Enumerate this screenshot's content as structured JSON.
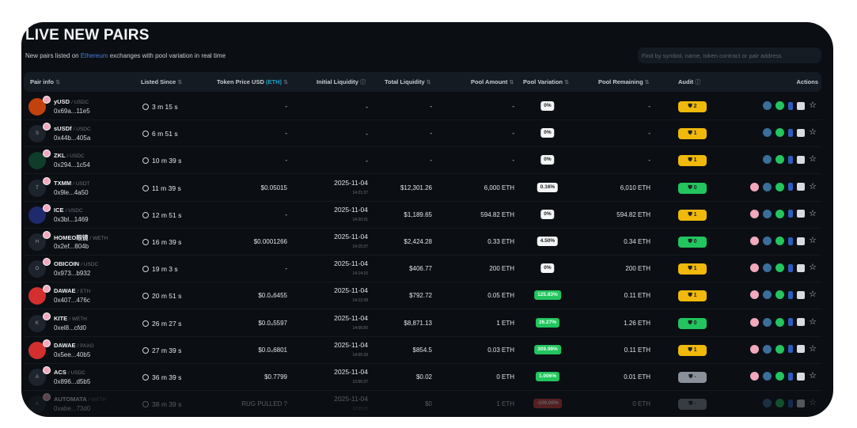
{
  "header": {
    "title": "LIVE NEW PAIRS",
    "subtitle_pre": "New pairs listed on ",
    "subtitle_link": "Ethereum",
    "subtitle_post": " exchanges with pool variation in real time",
    "search_placeholder": "Find by symbol, name, token contract or pair address"
  },
  "columns": {
    "pair_info": "Pair info",
    "listed_since": "Listed Since",
    "token_price": "Token Price USD",
    "token_price_unit": "(ETH)",
    "initial_liquidity": "Initial Liquidity",
    "total_liquidity": "Total Liquidity",
    "pool_amount": "Pool Amount",
    "pool_variation": "Pool Variation",
    "pool_remaining": "Pool Remaining",
    "audit": "Audit",
    "actions": "Actions"
  },
  "colors": {
    "audit_warn": "#f0b90b",
    "audit_ok": "#22c55e",
    "audit_none": "#8a9099",
    "variation_up": "#22c55e",
    "variation_down": "#e03e3e",
    "link": "#4b7bd8"
  },
  "rows": [
    {
      "symbol": "yUSD",
      "quote": "USDC",
      "address": "0x69a...11e5",
      "since": "3 m 15 s",
      "price": "-",
      "init_date": "-",
      "init_time": "",
      "total": "-",
      "amount": "-",
      "variation": "0%",
      "var_type": "neutral",
      "remaining": "-",
      "audit": "2",
      "audit_type": "warn",
      "avatar": "",
      "avatar_color": "#c2410c",
      "pink": false
    },
    {
      "symbol": "sUSDf",
      "quote": "USDC",
      "address": "0x44b...405a",
      "since": "6 m 51 s",
      "price": "-",
      "init_date": "-",
      "init_time": "",
      "total": "-",
      "amount": "-",
      "variation": "0%",
      "var_type": "neutral",
      "remaining": "-",
      "audit": "1",
      "audit_type": "warn",
      "avatar": "S",
      "pink": false
    },
    {
      "symbol": "ZKL",
      "quote": "USDC",
      "address": "0x294...1c54",
      "since": "10 m 39 s",
      "price": "-",
      "init_date": "-",
      "init_time": "",
      "total": "-",
      "amount": "-",
      "variation": "0%",
      "var_type": "neutral",
      "remaining": "-",
      "audit": "1",
      "audit_type": "warn",
      "avatar": "",
      "avatar_color": "#0f3d2a",
      "pink": false
    },
    {
      "symbol": "TXMM",
      "quote": "USDT",
      "address": "0x9le...4a50",
      "since": "11 m 39 s",
      "price": "$0.05015",
      "init_date": "2025-11-04",
      "init_time": "14:21:37",
      "total": "$12,301.26",
      "amount": "6,000 ETH",
      "variation": "0.16%",
      "var_type": "neutral",
      "remaining": "6,010 ETH",
      "audit": "0",
      "audit_type": "ok",
      "avatar": "T",
      "pink": true
    },
    {
      "symbol": "ICE",
      "quote": "USDC",
      "address": "0x3bl...1469",
      "since": "12 m 51 s",
      "price": "-",
      "init_date": "2025-11-04",
      "init_time": "14:20:31",
      "total": "$1,189.65",
      "amount": "594.82 ETH",
      "variation": "0%",
      "var_type": "neutral",
      "remaining": "594.82 ETH",
      "audit": "1",
      "audit_type": "warn",
      "avatar": "",
      "avatar_color": "#1e2a6b",
      "pink": true
    },
    {
      "symbol": "HOMEO眼镜",
      "quote": "WETH",
      "address": "0x2ef...804b",
      "since": "16 m 39 s",
      "price": "$0.0001266",
      "init_date": "2025-11-04",
      "init_time": "14:15:37",
      "total": "$2,424.28",
      "amount": "0.33 ETH",
      "variation": "4.50%",
      "var_type": "neutral",
      "remaining": "0.34 ETH",
      "audit": "0",
      "audit_type": "ok",
      "avatar": "H",
      "pink": true
    },
    {
      "symbol": "OBICOIN",
      "quote": "USDC",
      "address": "0x973...b932",
      "since": "19 m 3 s",
      "price": "-",
      "init_date": "2025-11-04",
      "init_time": "14:14:15",
      "total": "$406.77",
      "amount": "200 ETH",
      "variation": "0%",
      "var_type": "neutral",
      "remaining": "200 ETH",
      "audit": "1",
      "audit_type": "warn",
      "avatar": "O",
      "pink": true
    },
    {
      "symbol": "DAWAE",
      "quote": "ETH",
      "address": "0x407...476c",
      "since": "20 m 51 s",
      "price": "$0.0₄6455",
      "init_date": "2025-11-04",
      "init_time": "14:12:28",
      "total": "$792.72",
      "amount": "0.05 ETH",
      "variation": "125.83%",
      "var_type": "up",
      "remaining": "0.11 ETH",
      "audit": "1",
      "audit_type": "warn",
      "avatar": "",
      "avatar_color": "#d32f2f",
      "pink": true
    },
    {
      "symbol": "KITE",
      "quote": "WETH",
      "address": "0xel8...cfd0",
      "since": "26 m 27 s",
      "price": "$0.0₄5597",
      "init_date": "2025-11-04",
      "init_time": "14:06:50",
      "total": "$8,871.13",
      "amount": "1 ETH",
      "variation": "26.27%",
      "var_type": "up",
      "remaining": "1.26 ETH",
      "audit": "0",
      "audit_type": "ok",
      "avatar": "K",
      "pink": true
    },
    {
      "symbol": "DAWAE",
      "quote": "PAXG",
      "address": "0x5ee...40b5",
      "since": "27 m 39 s",
      "price": "$0.0₄6801",
      "init_date": "2025-11-04",
      "init_time": "14:05:39",
      "total": "$854.5",
      "amount": "0.03 ETH",
      "variation": "309.99%",
      "var_type": "up",
      "remaining": "0.11 ETH",
      "audit": "1",
      "audit_type": "warn",
      "avatar": "",
      "avatar_color": "#d32f2f",
      "pink": true
    },
    {
      "symbol": "ACS",
      "quote": "USDC",
      "address": "0x896...d5b5",
      "since": "36 m 39 s",
      "price": "$0.7799",
      "init_date": "2025-11-04",
      "init_time": "13:56:37",
      "total": "$0.02",
      "amount": "0 ETH",
      "variation": "1.006%",
      "var_type": "up",
      "remaining": "0.01 ETH",
      "audit": "-",
      "audit_type": "none",
      "avatar": "A",
      "pink": true
    },
    {
      "symbol": "AUTOMATA",
      "quote": "WETH",
      "address": "0xabe...73d0",
      "since": "38 m 39 s",
      "price": "RUG PULLED ?",
      "init_date": "2025-11-04",
      "init_time": "13:55:25",
      "total": "$0",
      "amount": "1 ETH",
      "variation": "-100.00%",
      "var_type": "down",
      "remaining": "0 ETH",
      "audit": "-",
      "audit_type": "none",
      "avatar": "A",
      "pink": false,
      "faded": true
    }
  ]
}
